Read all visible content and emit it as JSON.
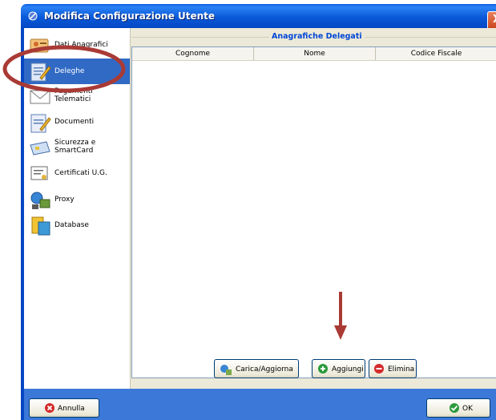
{
  "window": {
    "title": "Modifica Configurazione Utente",
    "close_label": "X"
  },
  "sidebar": {
    "items": [
      {
        "label": "Dati Anagrafici"
      },
      {
        "label": "Deleghe"
      },
      {
        "label": "Pagamenti Telematici",
        "line1": "Pagamenti",
        "line2": "Telematici"
      },
      {
        "label": "Documenti"
      },
      {
        "label": "Sicurezza e SmartCard",
        "line1": "Sicurezza e",
        "line2": "SmartCard"
      },
      {
        "label": "Certificati U.G."
      },
      {
        "label": "Proxy"
      },
      {
        "label": "Database"
      }
    ]
  },
  "group": {
    "title": "Anagrafiche Delegati"
  },
  "table": {
    "columns": [
      "Cognome",
      "Nome",
      "Codice Fiscale"
    ],
    "rows": []
  },
  "buttons": {
    "reload": "Carica/Aggiorna",
    "add": "Aggiungi",
    "delete": "Elimina",
    "cancel": "Annulla",
    "ok": "OK"
  },
  "colors": {
    "selection": "#316ac5",
    "annotation": "#a93a35",
    "titlebar": "#0a5ad9"
  }
}
